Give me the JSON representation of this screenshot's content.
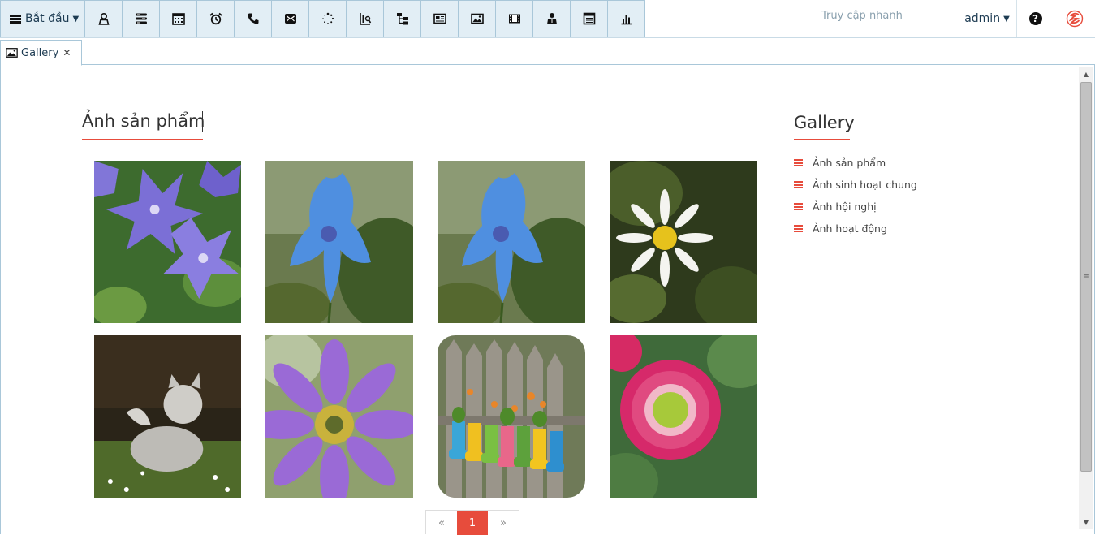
{
  "topbar": {
    "start_label": "Bắt đầu",
    "quick_access_placeholder": "Truy cập nhanh",
    "user_label": "admin",
    "help_glyph": "?",
    "tools": [
      "user-icon",
      "list-icon",
      "calendar-icon",
      "alarm-icon",
      "phone-icon",
      "mail-icon",
      "loading-icon",
      "report-icon",
      "org-chart-icon",
      "news-icon",
      "image-icon",
      "video-icon",
      "person-icon",
      "document-icon",
      "chart-icon"
    ]
  },
  "tab": {
    "label": "Gallery",
    "close_glyph": "✕"
  },
  "main": {
    "title": "Ảnh sản phẩm",
    "photos": [
      "purple bellflowers",
      "blue poppy",
      "blue poppy",
      "white daisy",
      "grey kitten",
      "purple anemone",
      "rain boots planters",
      "pink daisy"
    ]
  },
  "sidebar": {
    "title": "Gallery",
    "items": [
      "Ảnh sản phẩm",
      "Ảnh sinh hoạt chung",
      "Ảnh hội nghị",
      "Ảnh hoạt động"
    ]
  },
  "pager": {
    "prev": "«",
    "current": "1",
    "next": "»"
  },
  "colors": {
    "accent": "#e74c3c",
    "toolbar_bg": "#e2eef5",
    "toolbar_border": "#a9c7d9"
  }
}
